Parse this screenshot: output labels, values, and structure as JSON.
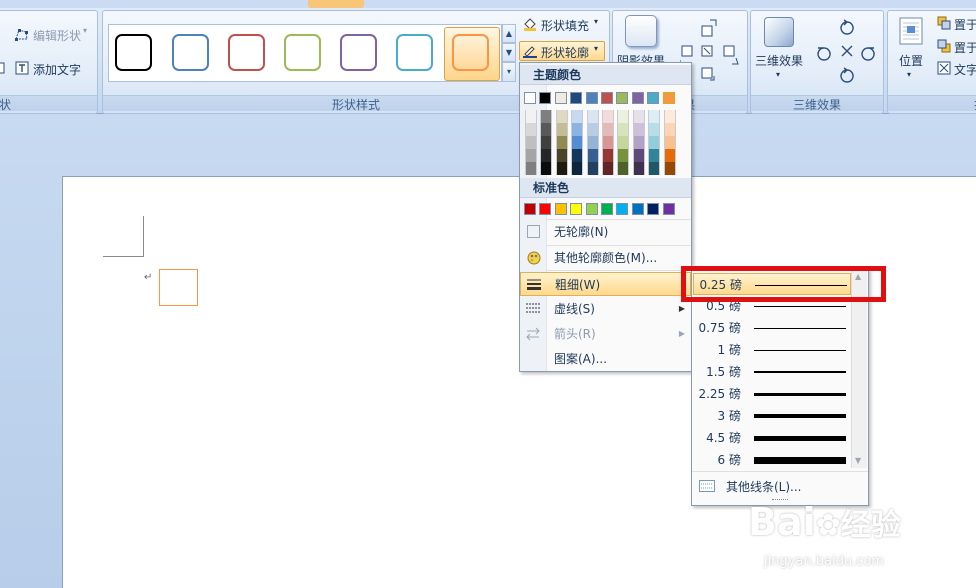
{
  "ribbon": {
    "edit_shape": "编辑形状",
    "add_text": "添加文字",
    "group_left_partial": "状",
    "shape_styles_title": "形状样式",
    "shape_fill": "形状填充",
    "shape_outline": "形状轮廓",
    "shadow_effects": "阴影效果",
    "shadow_group_partial": "果",
    "three_d_effects": "三维效果",
    "three_d_group": "三维效果",
    "position": "位置",
    "bring_forward_partial": "置于",
    "send_backward_partial": "置于",
    "text_wrap_partial": "文字",
    "arrange_partial": "排"
  },
  "gallery_swatches": [
    {
      "border": "#000000"
    },
    {
      "border": "#4f81bd"
    },
    {
      "border": "#c0504d"
    },
    {
      "border": "#9bbb59"
    },
    {
      "border": "#8064a2"
    },
    {
      "border": "#4bacc6"
    },
    {
      "border": "#f79646"
    }
  ],
  "menu": {
    "theme_colors_title": "主题颜色",
    "theme_colors": [
      "#ffffff",
      "#000000",
      "#eeece1",
      "#1f497d",
      "#4f81bd",
      "#c0504d",
      "#9bbb59",
      "#8064a2",
      "#4bacc6",
      "#f79646"
    ],
    "theme_tints": [
      [
        "#f2f2f2",
        "#d8d8d8",
        "#bfbfbf",
        "#a5a5a5",
        "#7f7f7f"
      ],
      [
        "#7f7f7f",
        "#595959",
        "#3f3f3f",
        "#262626",
        "#0c0c0c"
      ],
      [
        "#ddd9c3",
        "#c4bd97",
        "#938953",
        "#494429",
        "#1d1b10"
      ],
      [
        "#c6d9f0",
        "#8db3e2",
        "#548dd4",
        "#17365d",
        "#0f243e"
      ],
      [
        "#dbe5f1",
        "#b8cce4",
        "#95b3d7",
        "#366092",
        "#244061"
      ],
      [
        "#f2dcdb",
        "#e5b9b7",
        "#d99694",
        "#953734",
        "#632423"
      ],
      [
        "#ebf1dd",
        "#d7e3bc",
        "#c3d69b",
        "#76923c",
        "#4f6128"
      ],
      [
        "#e5e0ec",
        "#ccc1d9",
        "#b2a2c7",
        "#5f497a",
        "#3f3151"
      ],
      [
        "#dbeef3",
        "#b7dde8",
        "#92cddc",
        "#31859b",
        "#205867"
      ],
      [
        "#fdeada",
        "#fbd5b5",
        "#fac08f",
        "#e36c09",
        "#974806"
      ]
    ],
    "standard_colors_title": "标准色",
    "standard_colors": [
      "#c00000",
      "#ff0000",
      "#ffc000",
      "#ffff00",
      "#92d050",
      "#00b050",
      "#00b0f0",
      "#0070c0",
      "#002060",
      "#7030a0"
    ],
    "no_outline": "无轮廓(N)",
    "more_colors": "其他轮廓颜色(M)...",
    "weight": "粗细(W)",
    "dashes": "虚线(S)",
    "arrows": "箭头(R)",
    "pattern": "图案(A)..."
  },
  "weights": {
    "items": [
      {
        "label": "0.25 磅",
        "pt": 0.25
      },
      {
        "label": "0.5 磅",
        "pt": 0.5
      },
      {
        "label": "0.75 磅",
        "pt": 0.75
      },
      {
        "label": "1 磅",
        "pt": 1
      },
      {
        "label": "1.5 磅",
        "pt": 1.5
      },
      {
        "label": "2.25 磅",
        "pt": 2.25
      },
      {
        "label": "3 磅",
        "pt": 3
      },
      {
        "label": "4.5 磅",
        "pt": 4.5
      },
      {
        "label": "6 磅",
        "pt": 6
      }
    ],
    "more_lines": "其他线条(L)...",
    "highlight_color": "#e01010"
  },
  "document": {
    "paragraph_mark": "↵",
    "shape_border_color": "#f79646"
  },
  "watermark": {
    "brand": "Bai",
    "brand_cn": "经验",
    "url": "jingyan.baidu.com"
  }
}
